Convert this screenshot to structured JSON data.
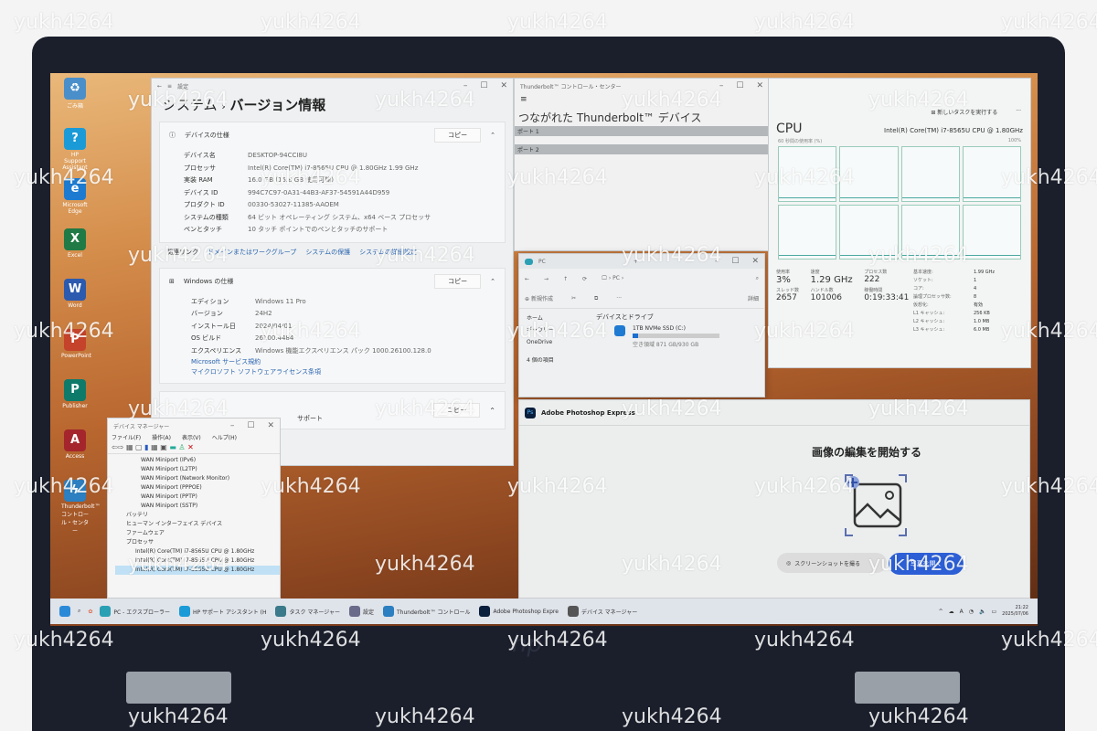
{
  "watermark": "yukh4264",
  "laptop_brand": "hp",
  "desktop_icons": [
    {
      "label": "ごみ箱",
      "color": "#4a8fc9",
      "glyph": "♻"
    },
    {
      "label": "HP Support Assistant",
      "color": "#1a9bd7",
      "glyph": "?"
    },
    {
      "label": "Microsoft Edge",
      "color": "#1c7bd1",
      "glyph": "e"
    },
    {
      "label": "Excel",
      "color": "#1f7a45",
      "glyph": "X"
    },
    {
      "label": "Word",
      "color": "#2b5aae",
      "glyph": "W"
    },
    {
      "label": "PowerPoint",
      "color": "#c4432a",
      "glyph": "P"
    },
    {
      "label": "Publisher",
      "color": "#0e7a6a",
      "glyph": "P"
    },
    {
      "label": "Access",
      "color": "#a4262c",
      "glyph": "A"
    },
    {
      "label": "Thunderbolt™ コントロール・センター",
      "color": "#2c7fc0",
      "glyph": "ϟ"
    }
  ],
  "settings": {
    "app": "設定",
    "breadcrumb_parent": "システム",
    "breadcrumb_sep": "›",
    "title": "バージョン情報",
    "device_spec": {
      "header": "デバイスの仕様",
      "copy": "コピー",
      "rows": [
        {
          "k": "デバイス名",
          "v": "DESKTOP-94CCI8U"
        },
        {
          "k": "プロセッサ",
          "v": "Intel(R) Core(TM) i7-8565U CPU @ 1.80GHz   1.99 GHz"
        },
        {
          "k": "実装 RAM",
          "v": "16.0 GB (15.8 GB 使用可能)"
        },
        {
          "k": "デバイス ID",
          "v": "994C7C97-0A31-44B3-AF37-54591A44D959"
        },
        {
          "k": "プロダクト ID",
          "v": "00330-53027-11385-AAOEM"
        },
        {
          "k": "システムの種類",
          "v": "64 ビット オペレーティング システム、x64 ベース プロセッサ"
        },
        {
          "k": "ペンとタッチ",
          "v": "10 タッチ ポイントでのペンとタッチのサポート"
        }
      ]
    },
    "related_links": {
      "label": "関連リンク",
      "links": [
        "ドメインまたはワークグループ",
        "システムの保護",
        "システムの詳細設定"
      ]
    },
    "windows_spec": {
      "header": "Windows の仕様",
      "copy": "コピー",
      "rows": [
        {
          "k": "エディション",
          "v": "Windows 11 Pro"
        },
        {
          "k": "バージョン",
          "v": "24H2"
        },
        {
          "k": "インストール日",
          "v": "2024/04/01"
        },
        {
          "k": "OS ビルド",
          "v": "26100.4484"
        },
        {
          "k": "エクスペリエンス",
          "v": "Windows 機能エクスペリエンス パック 1000.26100.128.0"
        }
      ],
      "links": [
        "Microsoft サービス規約",
        "マイクロソフト ソフトウェアライセンス条項"
      ]
    },
    "support": {
      "copy": "コピー",
      "label": "サポート"
    }
  },
  "thunderbolt": {
    "title": "Thunderbolt™ コントロール・センター",
    "heading": "つながれた Thunderbolt™ デバイス",
    "ports": [
      "ポート 1",
      "ポート 2"
    ]
  },
  "explorer": {
    "tab": "PC",
    "address": "PC",
    "new": "新規作成",
    "details": "詳細",
    "nav": [
      "ホーム",
      "ギャラリー",
      "OneDrive"
    ],
    "section": "デバイスとドライブ",
    "drive": {
      "name": "1TB NVMe SSD (C:)",
      "free": "空き領域 871 GB/930 GB",
      "used_fraction": 0.064
    },
    "status": "4 個の項目"
  },
  "taskmgr": {
    "run_task": "新しいタスクを実行する",
    "title": "CPU",
    "cpu_name": "Intel(R) Core(TM) i7-8565U CPU @ 1.80GHz",
    "graph_label": "60 秒間の使用率 (%)",
    "graph_max": "100%",
    "stats": [
      {
        "k": "使用率",
        "v": "3%"
      },
      {
        "k": "速度",
        "v": "1.29 GHz"
      },
      {
        "k": "プロセス数",
        "v": "222"
      },
      {
        "k": "スレッド数",
        "v": "2657"
      },
      {
        "k": "ハンドル数",
        "v": "101006"
      },
      {
        "k": "稼働時間",
        "v": "0:19:33:41"
      }
    ],
    "details": [
      {
        "k": "基本速度:",
        "v": "1.99 GHz"
      },
      {
        "k": "ソケット:",
        "v": "1"
      },
      {
        "k": "コア:",
        "v": "4"
      },
      {
        "k": "論理プロセッサ数:",
        "v": "8"
      },
      {
        "k": "仮想化:",
        "v": "有効"
      },
      {
        "k": "L1 キャッシュ:",
        "v": "256 KB"
      },
      {
        "k": "L2 キャッシュ:",
        "v": "1.0 MB"
      },
      {
        "k": "L3 キャッシュ:",
        "v": "6.0 MB"
      }
    ]
  },
  "photoshop": {
    "title": "Adobe Photoshop Express",
    "heading": "画像の編集を開始する",
    "screenshot_btn": "スクリーンショットを撮る",
    "primary_btn": "写真を開く"
  },
  "devmgr": {
    "title": "デバイス マネージャー",
    "menu": [
      "ファイル(F)",
      "操作(A)",
      "表示(V)",
      "ヘルプ(H)"
    ],
    "items": [
      "WAN Miniport (IPv6)",
      "WAN Miniport (L2TP)",
      "WAN Miniport (Network Monitor)",
      "WAN Miniport (PPPOE)",
      "WAN Miniport (PPTP)",
      "WAN Miniport (SSTP)"
    ],
    "categories": [
      "バッテリ",
      "ヒューマン インターフェイス デバイス",
      "ファームウェア",
      "プロセッサ"
    ],
    "cpus": [
      "Intel(R) Core(TM) i7-8565U CPU @ 1.80GHz",
      "Intel(R) Core(TM) i7-8565U CPU @ 1.80GHz",
      "Intel(R) Core(TM) i7-8565U CPU @ 1.80GHz"
    ]
  },
  "taskbar": {
    "apps": [
      "PC - エクスプローラー",
      "HP サポート アシスタント (H",
      "タスク マネージャー",
      "設定",
      "Thunderbolt™ コントロール",
      "Adobe Photoshop Expre",
      "デバイス マネージャー"
    ],
    "ime": "A",
    "time": "21:22",
    "date": "2025/07/06"
  }
}
